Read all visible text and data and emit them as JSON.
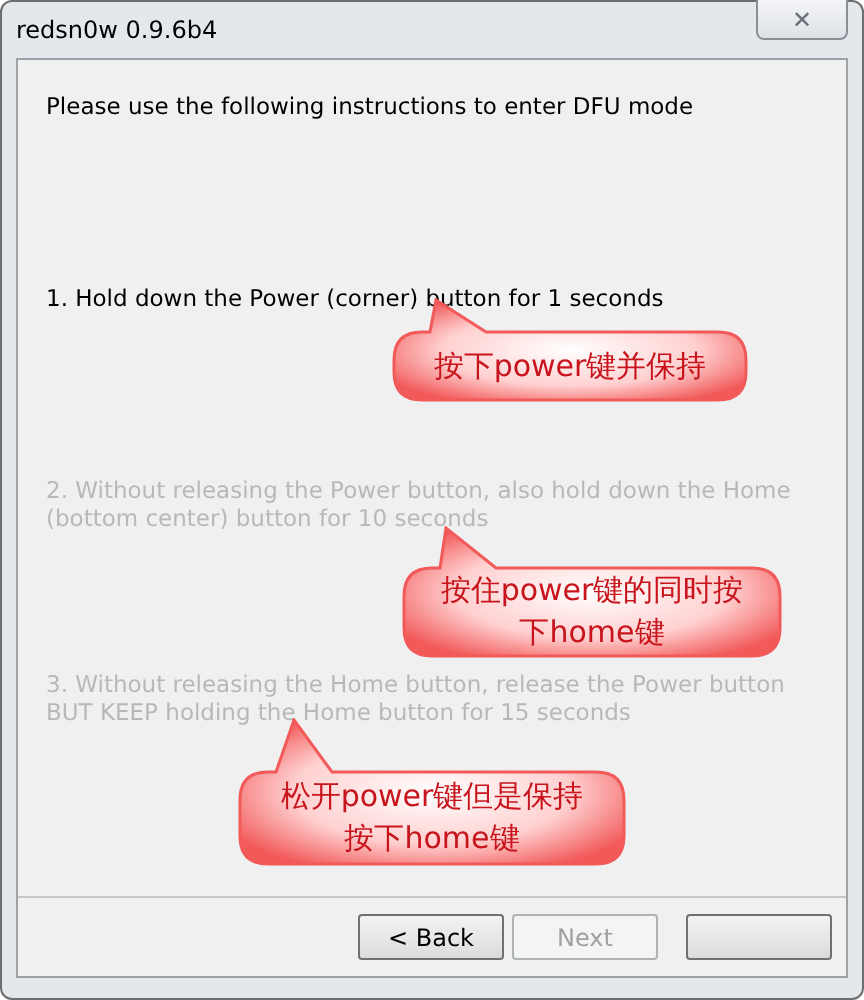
{
  "window": {
    "title": "redsn0w 0.9.6b4",
    "close_icon": "✕"
  },
  "heading": "Please use the following instructions to enter DFU mode",
  "steps": [
    {
      "text": "1. Hold down the Power (corner) button for 1 seconds",
      "enabled": true
    },
    {
      "text": "2. Without releasing the Power button, also hold down the Home (bottom center) button for 10 seconds",
      "enabled": false
    },
    {
      "text": "3. Without releasing the Home button, release the Power button BUT KEEP holding the Home button for 15 seconds",
      "enabled": false
    }
  ],
  "callouts": [
    {
      "text": "按下power键并保持",
      "color": "#f25a5a"
    },
    {
      "text": "按住power键的同时按下home键",
      "color": "#f25a5a"
    },
    {
      "text": "松开power键但是保持按下home键",
      "color": "#f25a5a"
    }
  ],
  "buttons": [
    {
      "label": "< Back",
      "disabled": false
    },
    {
      "label": "Next",
      "disabled": true
    },
    {
      "disabled": false
    }
  ]
}
